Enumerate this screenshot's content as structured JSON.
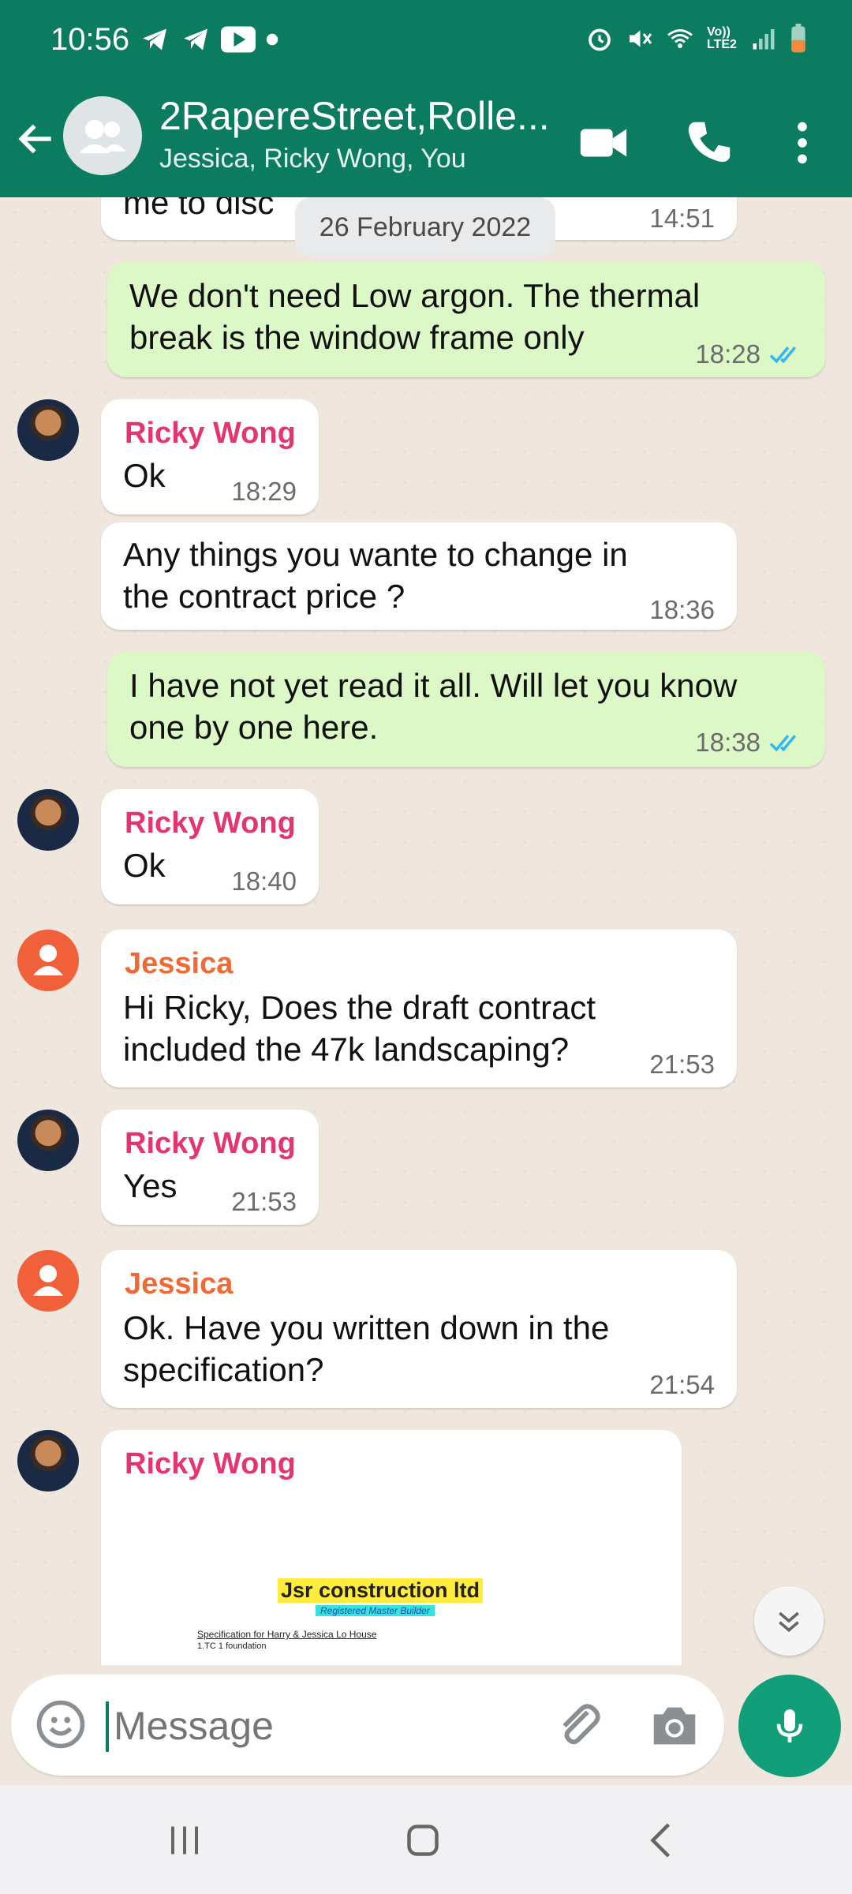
{
  "status": {
    "time": "10:56",
    "left_icons": [
      "telegram-icon",
      "telegram-icon",
      "youtube-icon",
      "dot-icon"
    ],
    "right_icons": [
      "alarm-icon",
      "mute-icon",
      "wifi-icon",
      "volte-icon",
      "signal-icon",
      "battery-icon"
    ],
    "volte_label": "Vo)) LTE2"
  },
  "header": {
    "title": "2RapereStreet,Rolle...",
    "subtitle": "Jessica, Ricky Wong, You",
    "icons": [
      "back-arrow-icon",
      "group-avatar-icon",
      "video-call-icon",
      "phone-icon",
      "more-vertical-icon"
    ]
  },
  "chat": {
    "top_partial": {
      "text": "me to disc",
      "time": "14:51"
    },
    "date_chip": "26 February 2022",
    "messages": [
      {
        "dir": "out",
        "lines": [
          "We don't  need Low argon. The thermal",
          "break is the window frame only"
        ],
        "time": "18:28",
        "ticks": "read"
      },
      {
        "dir": "in",
        "sender": "Ricky Wong",
        "lines": [
          "Ok"
        ],
        "time": "18:29"
      },
      {
        "dir": "in",
        "lines": [
          "Any things you wante to change in",
          "the contract price ?"
        ],
        "time": "18:36"
      },
      {
        "dir": "out",
        "lines": [
          "I have not yet read it all. Will let you know",
          "one by one here."
        ],
        "time": "18:38",
        "ticks": "read"
      },
      {
        "dir": "in",
        "sender": "Ricky Wong",
        "lines": [
          "Ok"
        ],
        "time": "18:40"
      },
      {
        "dir": "in",
        "sender": "Jessica",
        "lines": [
          "Hi Ricky, Does the draft contract",
          "included the 47k landscaping?"
        ],
        "time": "21:53"
      },
      {
        "dir": "in",
        "sender": "Ricky Wong",
        "lines": [
          "Yes"
        ],
        "time": "21:53"
      },
      {
        "dir": "in",
        "sender": "Jessica",
        "lines": [
          "Ok. Have you written down in the",
          "specification?"
        ],
        "time": "21:54"
      },
      {
        "dir": "in",
        "sender": "Ricky Wong",
        "document": {
          "company": "Jsr construction ltd",
          "registered": "Registered Master Builder",
          "spec": "Specification for Harry & Jessica Lo House",
          "item": "1.TC 1 foundation"
        }
      }
    ]
  },
  "input": {
    "placeholder": "Message",
    "icons": [
      "emoji-icon",
      "attach-icon",
      "camera-icon",
      "mic-icon"
    ]
  },
  "navbar": {
    "icons": [
      "recent-apps-icon",
      "home-icon",
      "back-icon"
    ]
  },
  "colors": {
    "header": "#0b7c60",
    "chat_bg": "#efe7dd",
    "outgoing_bubble": "#dcf8c6",
    "incoming_bubble": "#ffffff",
    "ricky_name": "#e4356f",
    "jessica_name": "#f06a36",
    "read_tick": "#34b7f1",
    "mic_button": "#129e78"
  }
}
